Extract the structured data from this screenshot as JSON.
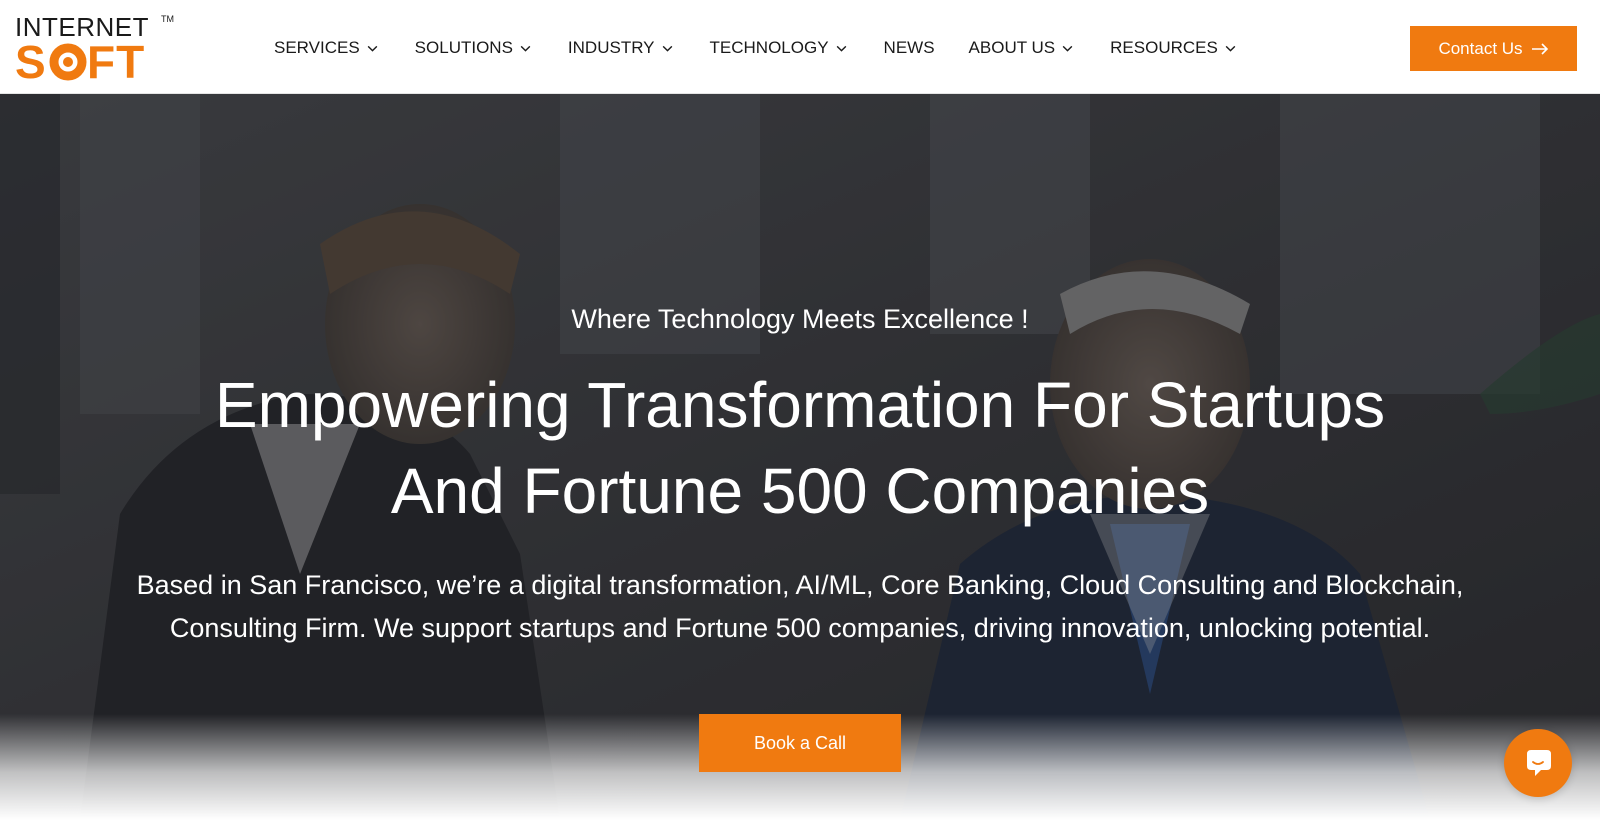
{
  "brand": {
    "logo_line1": "INTERNET",
    "logo_trademark": "TM",
    "logo_line2": "SOFT",
    "accent_color": "#f07a10"
  },
  "nav": {
    "items": [
      {
        "label": "SERVICES",
        "has_dropdown": true
      },
      {
        "label": "SOLUTIONS",
        "has_dropdown": true
      },
      {
        "label": "INDUSTRY",
        "has_dropdown": true
      },
      {
        "label": "TECHNOLOGY",
        "has_dropdown": true
      },
      {
        "label": "NEWS",
        "has_dropdown": false
      },
      {
        "label": "ABOUT US",
        "has_dropdown": true
      },
      {
        "label": "RESOURCES",
        "has_dropdown": true
      }
    ],
    "contact_label": "Contact Us",
    "contact_icon": "arrow-right-icon"
  },
  "hero": {
    "eyebrow": "Where Technology Meets Excellence !",
    "title_line1": "Empowering Transformation For Startups",
    "title_line2": "And Fortune 500 Companies",
    "description_line1": "Based in San Francisco, we’re a digital transformation, AI/ML, Core Banking, Cloud Consulting and Blockchain,",
    "description_line2": "Consulting Firm. We support startups and Fortune 500 companies, driving innovation, unlocking potential.",
    "cta_label": "Book a Call"
  },
  "chat": {
    "icon": "chat-icon"
  }
}
